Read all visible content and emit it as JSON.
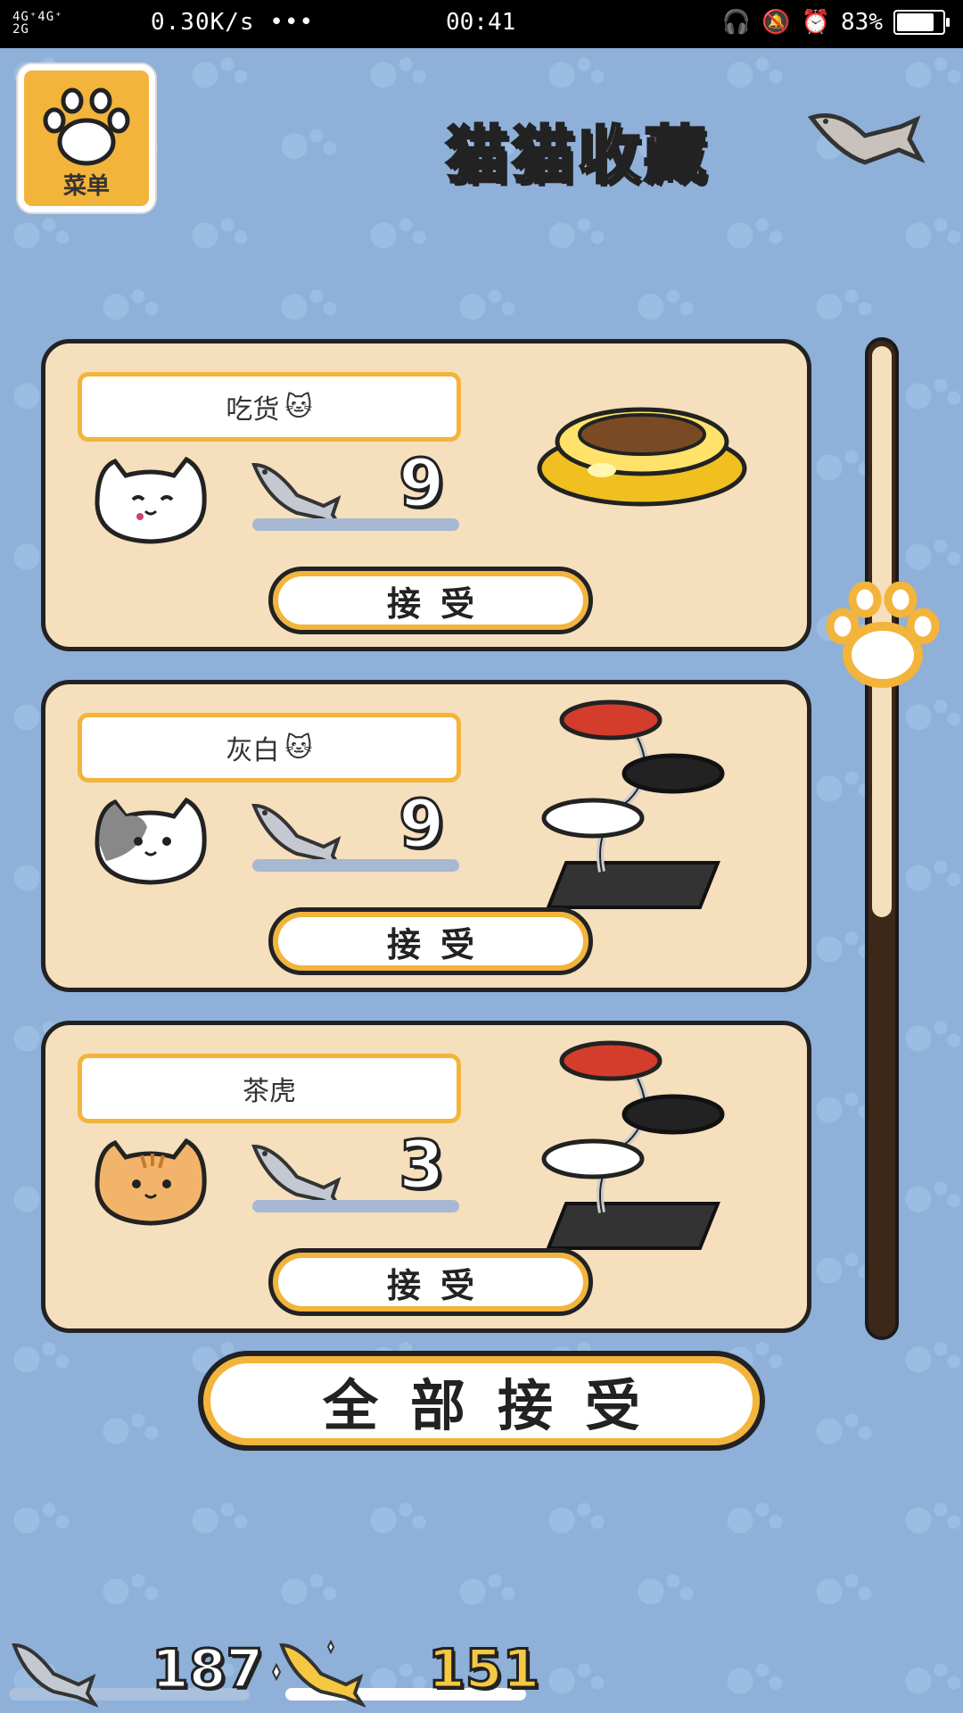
{
  "status_bar": {
    "network": "4G⁺4G⁺ 2G",
    "speed": "0.30K/s •••",
    "time": "00:41",
    "battery": "83%",
    "battery_level": 0.83
  },
  "header": {
    "menu_label": "菜单",
    "title": "猫猫收藏"
  },
  "cards": [
    {
      "name": "吃货",
      "cat": "white-cat",
      "fish_count": "9",
      "accept_label": "接受",
      "goods": "food-bowl"
    },
    {
      "name": "灰白",
      "cat": "grey-white-cat",
      "fish_count": "9",
      "accept_label": "接受",
      "goods": "cat-tower"
    },
    {
      "name": "茶虎",
      "cat": "orange-tabby-cat",
      "fish_count": "3",
      "accept_label": "接受",
      "goods": "cat-tower"
    }
  ],
  "accept_all_label": "全部接受",
  "currency": {
    "silver_fish": "187",
    "gold_fish": "151"
  },
  "colors": {
    "accent": "#f3b43b",
    "card_bg": "#f5dfbd",
    "background": "#8eb0d9",
    "outline": "#222222"
  }
}
